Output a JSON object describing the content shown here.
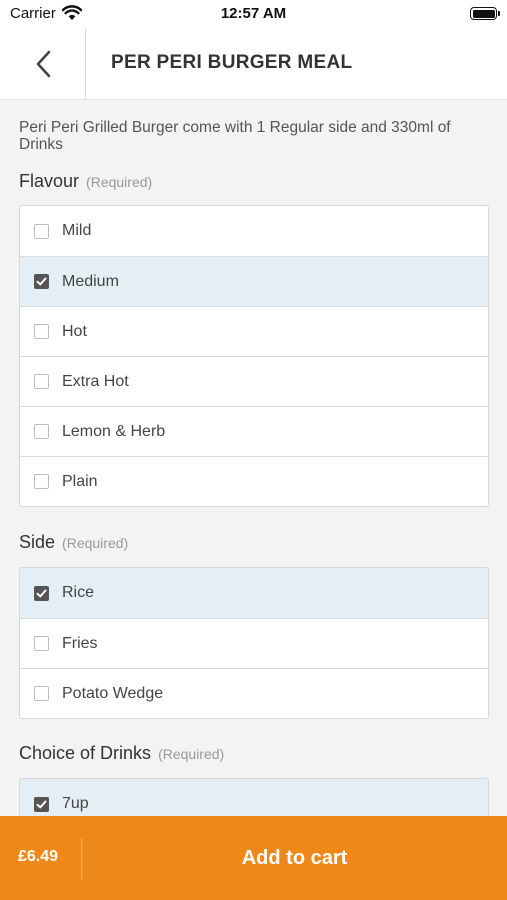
{
  "status_bar": {
    "carrier": "Carrier",
    "time": "12:57 AM"
  },
  "header": {
    "title": "PER PERI BURGER MEAL"
  },
  "description": "Peri Peri Grilled Burger come with 1 Regular side and 330ml of Drinks",
  "sections": [
    {
      "title": "Flavour",
      "required": "(Required)",
      "options": [
        {
          "label": "Mild",
          "checked": false
        },
        {
          "label": "Medium",
          "checked": true
        },
        {
          "label": "Hot",
          "checked": false
        },
        {
          "label": "Extra Hot",
          "checked": false
        },
        {
          "label": "Lemon & Herb",
          "checked": false
        },
        {
          "label": "Plain",
          "checked": false
        }
      ]
    },
    {
      "title": "Side",
      "required": "(Required)",
      "options": [
        {
          "label": "Rice",
          "checked": true
        },
        {
          "label": "Fries",
          "checked": false
        },
        {
          "label": "Potato Wedge",
          "checked": false
        }
      ]
    },
    {
      "title": "Choice of Drinks",
      "required": "(Required)",
      "options": [
        {
          "label": "7up",
          "checked": true
        }
      ]
    }
  ],
  "footer": {
    "price": "£6.49",
    "add_to_cart": "Add to cart"
  },
  "colors": {
    "accent": "#ee8919",
    "selected_row": "#e4eef5"
  },
  "icons": {
    "back": "chevron-left-icon",
    "wifi": "wifi-icon",
    "battery": "battery-icon",
    "check": "check-icon"
  }
}
